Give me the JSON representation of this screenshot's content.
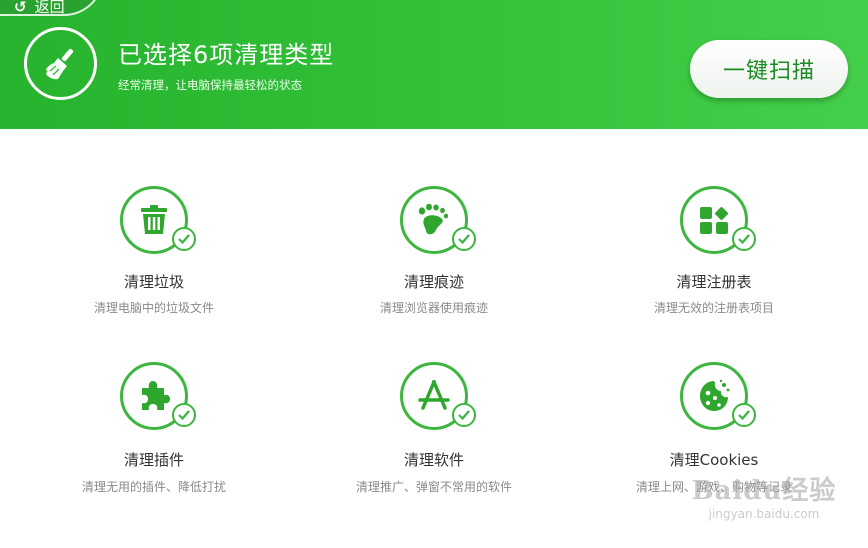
{
  "header": {
    "back_label": "返回",
    "title": "已选择6项清理类型",
    "subtitle": "经常清理，让电脑保持最轻松的状态",
    "scan_button": "一键扫描",
    "broom_icon": "broom-icon"
  },
  "items": [
    {
      "title": "清理垃圾",
      "desc": "清理电脑中的垃圾文件",
      "icon": "trash-icon",
      "checked": true
    },
    {
      "title": "清理痕迹",
      "desc": "清理浏览器使用痕迹",
      "icon": "footprint-icon",
      "checked": true
    },
    {
      "title": "清理注册表",
      "desc": "清理无效的注册表项目",
      "icon": "registry-blocks-icon",
      "checked": true
    },
    {
      "title": "清理插件",
      "desc": "清理无用的插件、降低打扰",
      "icon": "puzzle-icon",
      "checked": true
    },
    {
      "title": "清理软件",
      "desc": "清理推广、弹窗不常用的软件",
      "icon": "app-store-icon",
      "checked": true
    },
    {
      "title": "清理Cookies",
      "desc": "清理上网、游戏、购物等记录",
      "icon": "cookie-icon",
      "checked": true
    }
  ],
  "watermark": {
    "logo": "Baidu经验",
    "url": "jingyan.baidu.com"
  },
  "colors": {
    "header_green": "#33c23a",
    "accent_green": "#3cb63e",
    "button_text": "#1a8a22"
  }
}
